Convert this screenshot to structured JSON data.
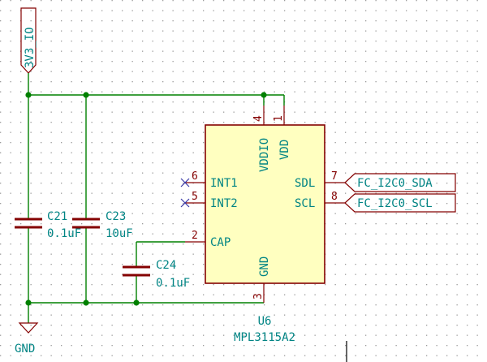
{
  "colors": {
    "wire": "#008000",
    "component_outline": "#840000",
    "component_fill": "#ffffc0",
    "text": "#008484",
    "grid_dot": "#9a9a9a",
    "no_connect": "#3a3aa8"
  },
  "power": {
    "supply_label": "3V3_IO",
    "ground_label": "GND"
  },
  "capacitors": [
    {
      "ref": "C21",
      "value": "0.1uF"
    },
    {
      "ref": "C23",
      "value": "10uF"
    },
    {
      "ref": "C24",
      "value": "0.1uF"
    }
  ],
  "ic": {
    "ref": "U6",
    "part": "MPL3115A2",
    "pins": {
      "vddio": {
        "number": "4",
        "name": "VDDIO"
      },
      "vdd": {
        "number": "1",
        "name": "VDD"
      },
      "int1": {
        "number": "6",
        "name": "INT1"
      },
      "int2": {
        "number": "5",
        "name": "INT2"
      },
      "cap": {
        "number": "2",
        "name": "CAP"
      },
      "gnd": {
        "number": "3",
        "name": "GND"
      },
      "sdl": {
        "number": "7",
        "name": "SDL"
      },
      "scl": {
        "number": "8",
        "name": "SCL"
      }
    }
  },
  "net_labels": {
    "sda": "FC_I2C0_SDA",
    "scl": "FC_I2C0_SCL"
  }
}
